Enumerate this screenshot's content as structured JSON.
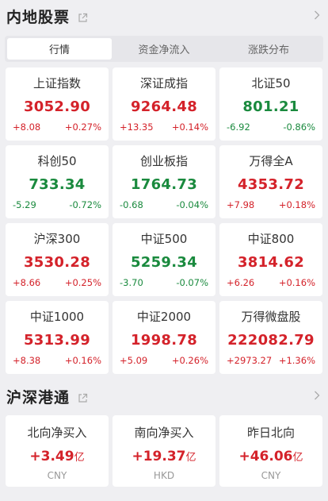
{
  "domestic": {
    "title": "内地股票",
    "tabs": [
      "行情",
      "资金净流入",
      "涨跌分布"
    ],
    "indices": [
      {
        "name": "上证指数",
        "price": "3052.90",
        "change": "+8.08",
        "pct": "+0.27%",
        "dir": "up"
      },
      {
        "name": "深证成指",
        "price": "9264.48",
        "change": "+13.35",
        "pct": "+0.14%",
        "dir": "up"
      },
      {
        "name": "北证50",
        "price": "801.21",
        "change": "-6.92",
        "pct": "-0.86%",
        "dir": "down"
      },
      {
        "name": "科创50",
        "price": "733.34",
        "change": "-5.29",
        "pct": "-0.72%",
        "dir": "down"
      },
      {
        "name": "创业板指",
        "price": "1764.73",
        "change": "-0.68",
        "pct": "-0.04%",
        "dir": "down"
      },
      {
        "name": "万得全A",
        "price": "4353.72",
        "change": "+7.98",
        "pct": "+0.18%",
        "dir": "up"
      },
      {
        "name": "沪深300",
        "price": "3530.28",
        "change": "+8.66",
        "pct": "+0.25%",
        "dir": "up"
      },
      {
        "name": "中证500",
        "price": "5259.34",
        "change": "-3.70",
        "pct": "-0.07%",
        "dir": "down"
      },
      {
        "name": "中证800",
        "price": "3814.62",
        "change": "+6.26",
        "pct": "+0.16%",
        "dir": "up"
      },
      {
        "name": "中证1000",
        "price": "5313.99",
        "change": "+8.38",
        "pct": "+0.16%",
        "dir": "up"
      },
      {
        "name": "中证2000",
        "price": "1998.78",
        "change": "+5.09",
        "pct": "+0.26%",
        "dir": "up"
      },
      {
        "name": "万得微盘股",
        "price": "222082.79",
        "change": "+2973.27",
        "pct": "+1.36%",
        "dir": "up"
      }
    ]
  },
  "connect": {
    "title": "沪深港通",
    "flows": [
      {
        "name": "北向净买入",
        "value": "+3.49",
        "unit": "亿",
        "currency": "CNY"
      },
      {
        "name": "南向净买入",
        "value": "+19.37",
        "unit": "亿",
        "currency": "HKD"
      },
      {
        "name": "昨日北向",
        "value": "+46.06",
        "unit": "亿",
        "currency": "CNY"
      }
    ]
  },
  "colors": {
    "up": "#d4222a",
    "down": "#1a8a3e"
  },
  "icons": {
    "share": "share-icon",
    "more": "chevron-right-icon"
  }
}
